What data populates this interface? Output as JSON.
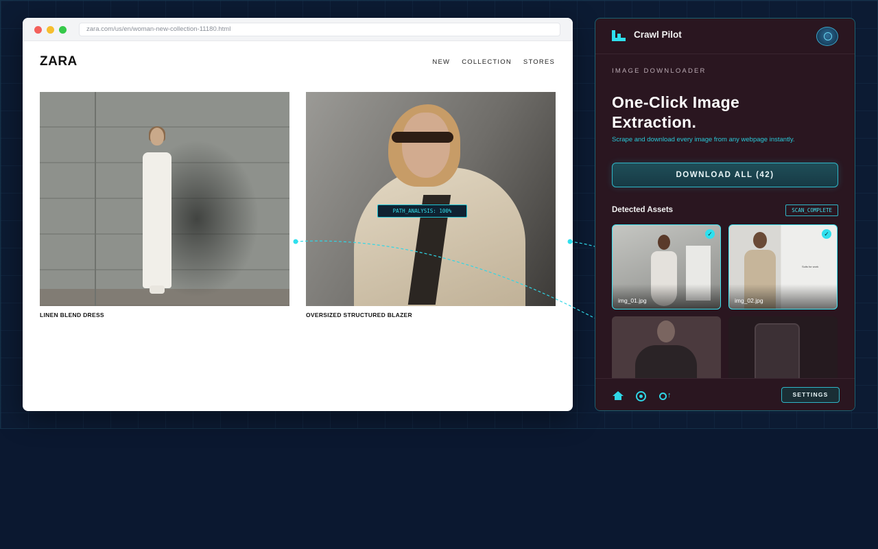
{
  "browser": {
    "url": "zara.com/us/en/woman-new-collection-11180.html"
  },
  "site": {
    "logo": "ZARA",
    "nav": [
      "NEW",
      "COLLECTION",
      "STORES"
    ],
    "products": [
      {
        "name": "LINEN BLEND DRESS"
      },
      {
        "name": "OVERSIZED STRUCTURED BLAZER"
      }
    ],
    "analysis_tag": "PATH_ANALYSIS: 100%"
  },
  "panel": {
    "brand": "Crawl Pilot",
    "eyebrow": "IMAGE DOWNLOADER",
    "headline_1": "One-Click Image",
    "headline_2": "Extraction.",
    "subtitle": "Scrape and download every image from any webpage instantly.",
    "download_button": "DOWNLOAD ALL (42)",
    "assets_title": "Detected Assets",
    "scan_status": "SCAN_COMPLETE",
    "assets": [
      {
        "filename": "img_01.jpg",
        "selected": true
      },
      {
        "filename": "img_02.jpg",
        "selected": true
      },
      {
        "filename": "",
        "selected": false
      },
      {
        "filename": "",
        "selected": false
      }
    ],
    "asset_2_screen_text": "Suits for work",
    "footer_icons": [
      "home-icon",
      "target-icon",
      "sync-icon"
    ],
    "settings_button": "SETTINGS"
  },
  "colors": {
    "background": "#0b1830",
    "accent": "#2fe0ee",
    "panel": "#2a1620"
  }
}
